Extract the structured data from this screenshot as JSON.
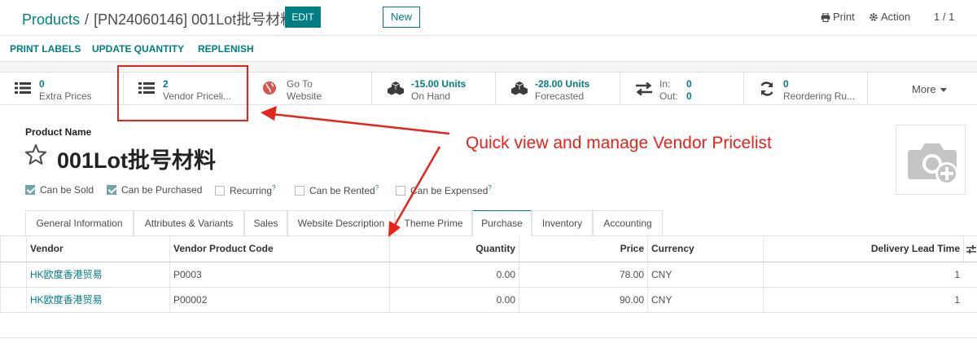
{
  "breadcrumb": {
    "root": "Products",
    "separator": "/",
    "current": "[PN24060146] 001Lot批号材料"
  },
  "control": {
    "edit_label": "EDIT",
    "new_label": "New",
    "print_label": "Print",
    "action_label": "Action",
    "pager": "1 / 1"
  },
  "header_actions": [
    "PRINT LABELS",
    "UPDATE QUANTITY",
    "REPLENISH"
  ],
  "smart_buttons": {
    "extra_prices": {
      "value": "0",
      "label": "Extra Prices"
    },
    "vendor_pricelist": {
      "value": "2",
      "label": "Vendor Priceli..."
    },
    "website": {
      "line1": "Go To",
      "line2": "Website"
    },
    "on_hand": {
      "value": "-15.00 Units",
      "label": "On Hand"
    },
    "forecasted": {
      "value": "-28.00 Units",
      "label": "Forecasted"
    },
    "in_out": {
      "in_label": "In:",
      "in_value": "0",
      "out_label": "Out:",
      "out_value": "0"
    },
    "reordering": {
      "value": "0",
      "label": "Reordering Ru..."
    },
    "more_label": "More"
  },
  "form": {
    "name_label": "Product Name",
    "name": "001Lot批号材料",
    "checkboxes": [
      {
        "label": "Can be Sold",
        "checked": true
      },
      {
        "label": "Can be Purchased",
        "checked": true
      },
      {
        "label": "Recurring",
        "checked": false,
        "sup": "?"
      },
      {
        "label": "Can be Rented",
        "checked": false,
        "sup": "?"
      },
      {
        "label": "Can be Expensed",
        "checked": false,
        "sup": "?"
      }
    ]
  },
  "tabs": [
    "General Information",
    "Attributes & Variants",
    "Sales",
    "Website Description",
    "Theme Prime",
    "Purchase",
    "Inventory",
    "Accounting"
  ],
  "active_tab": "Purchase",
  "table": {
    "headers": {
      "vendor": "Vendor",
      "code": "Vendor Product Code",
      "quantity": "Quantity",
      "price": "Price",
      "currency": "Currency",
      "lead": "Delivery Lead Time"
    },
    "rows": [
      {
        "vendor": "HK欧度香港贸易",
        "code": "P0003",
        "quantity": "0.00",
        "price": "78.00",
        "currency": "CNY",
        "lead": "1"
      },
      {
        "vendor": "HK欧度香港贸易",
        "code": "P00002",
        "quantity": "0.00",
        "price": "90.00",
        "currency": "CNY",
        "lead": "1"
      }
    ]
  },
  "annotation": "Quick view and manage Vendor Pricelist",
  "colors": {
    "accent": "#017e84",
    "annotation": "#e8231a"
  }
}
